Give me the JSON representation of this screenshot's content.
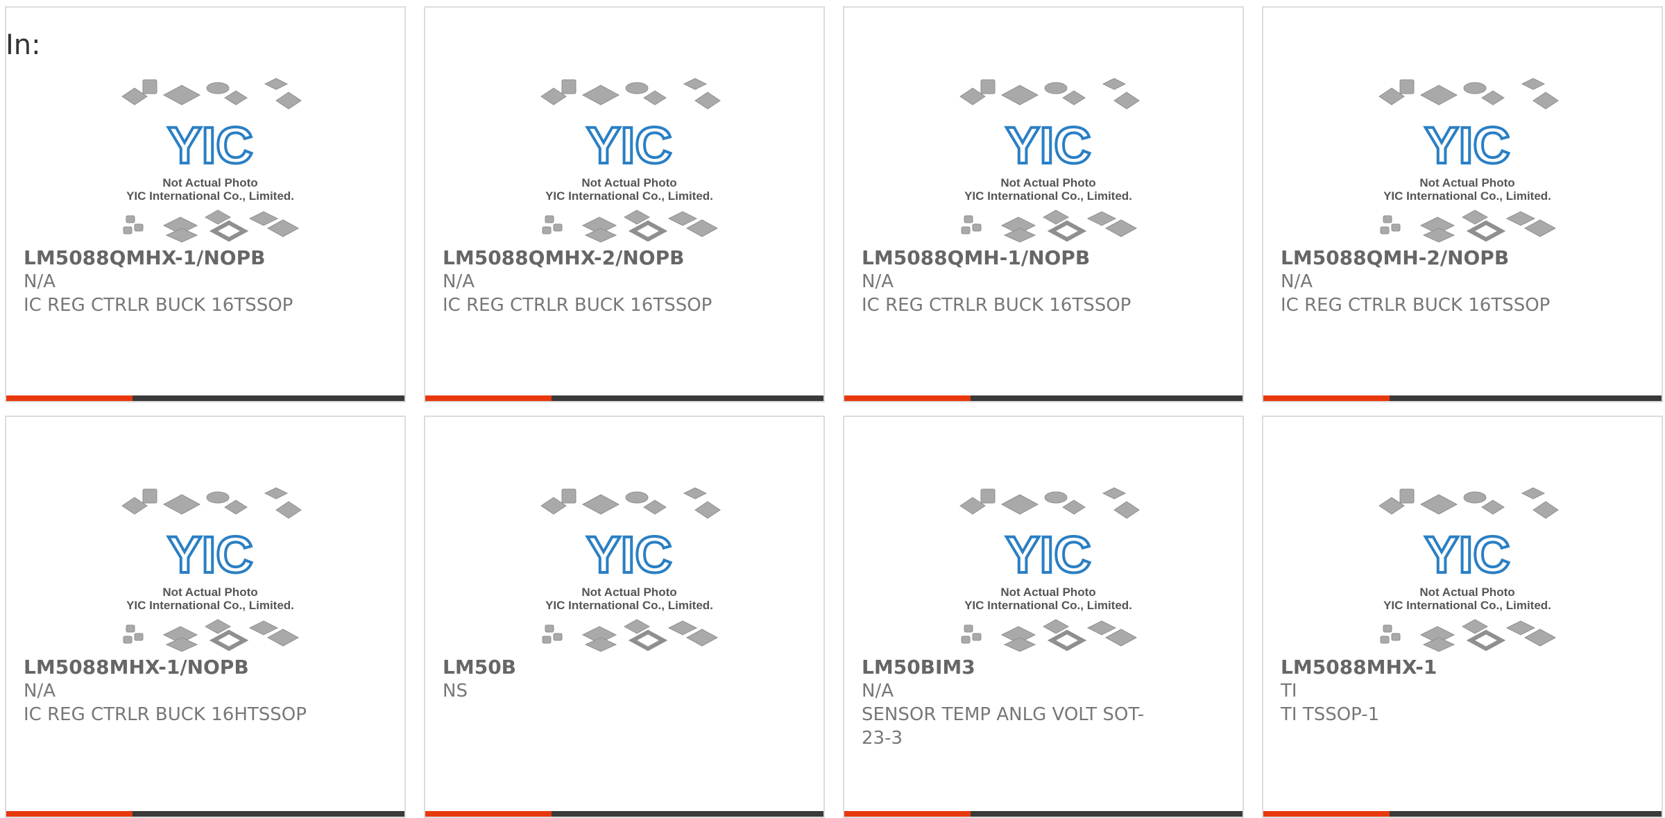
{
  "header": {
    "label": "In:"
  },
  "placeholder": {
    "line1": "Not Actual Photo",
    "line2": "YIC International Co., Limited.",
    "logo_text": "YIC"
  },
  "colors": {
    "accent": "#e8380d",
    "bar_dark": "#3a3a3a",
    "logo_blue": "#2a7fc4",
    "card_border": "#dcdcdc"
  },
  "products": [
    {
      "part": "LM5088QMHX-1/NOPB",
      "mfr": "N/A",
      "desc": "IC REG CTRLR BUCK 16TSSOP"
    },
    {
      "part": "LM5088QMHX-2/NOPB",
      "mfr": "N/A",
      "desc": "IC REG CTRLR BUCK 16TSSOP"
    },
    {
      "part": "LM5088QMH-1/NOPB",
      "mfr": "N/A",
      "desc": "IC REG CTRLR BUCK 16TSSOP"
    },
    {
      "part": "LM5088QMH-2/NOPB",
      "mfr": "N/A",
      "desc": "IC REG CTRLR BUCK 16TSSOP"
    },
    {
      "part": "LM5088MHX-1/NOPB",
      "mfr": "N/A",
      "desc": "IC REG CTRLR BUCK 16HTSSOP"
    },
    {
      "part": "LM50B",
      "mfr": "NS",
      "desc": ""
    },
    {
      "part": "LM50BIM3",
      "mfr": "N/A",
      "desc": "SENSOR TEMP ANLG VOLT SOT-23-3"
    },
    {
      "part": "LM5088MHX-1",
      "mfr": "TI",
      "desc": "TI TSSOP-1"
    }
  ]
}
